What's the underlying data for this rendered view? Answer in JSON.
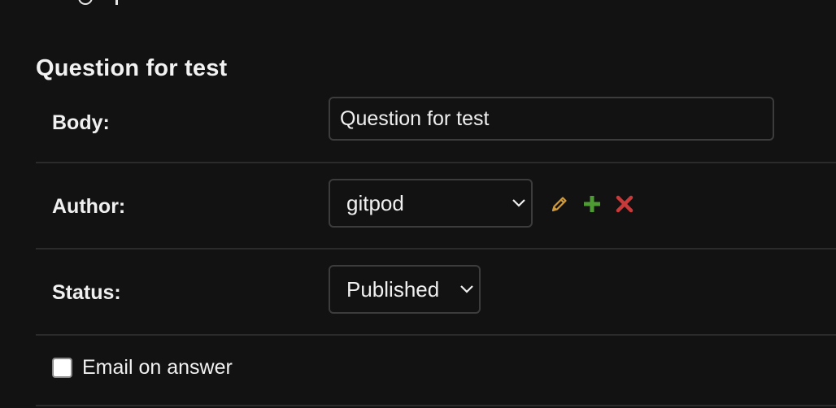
{
  "fieldset": {
    "title": "Question for test"
  },
  "fields": {
    "body": {
      "label": "Body:",
      "value": "Question for test"
    },
    "author": {
      "label": "Author:",
      "selected": "gitpod",
      "actions": [
        "pencil-icon",
        "plus-icon",
        "close-icon"
      ]
    },
    "status": {
      "label": "Status:",
      "selected": "Published"
    },
    "email_on_answer": {
      "label": "Email on answer",
      "checked": false
    }
  },
  "colors": {
    "background": "#121212",
    "edit": "#d19a3a",
    "add": "#4f9b33",
    "delete": "#c83a3a"
  }
}
